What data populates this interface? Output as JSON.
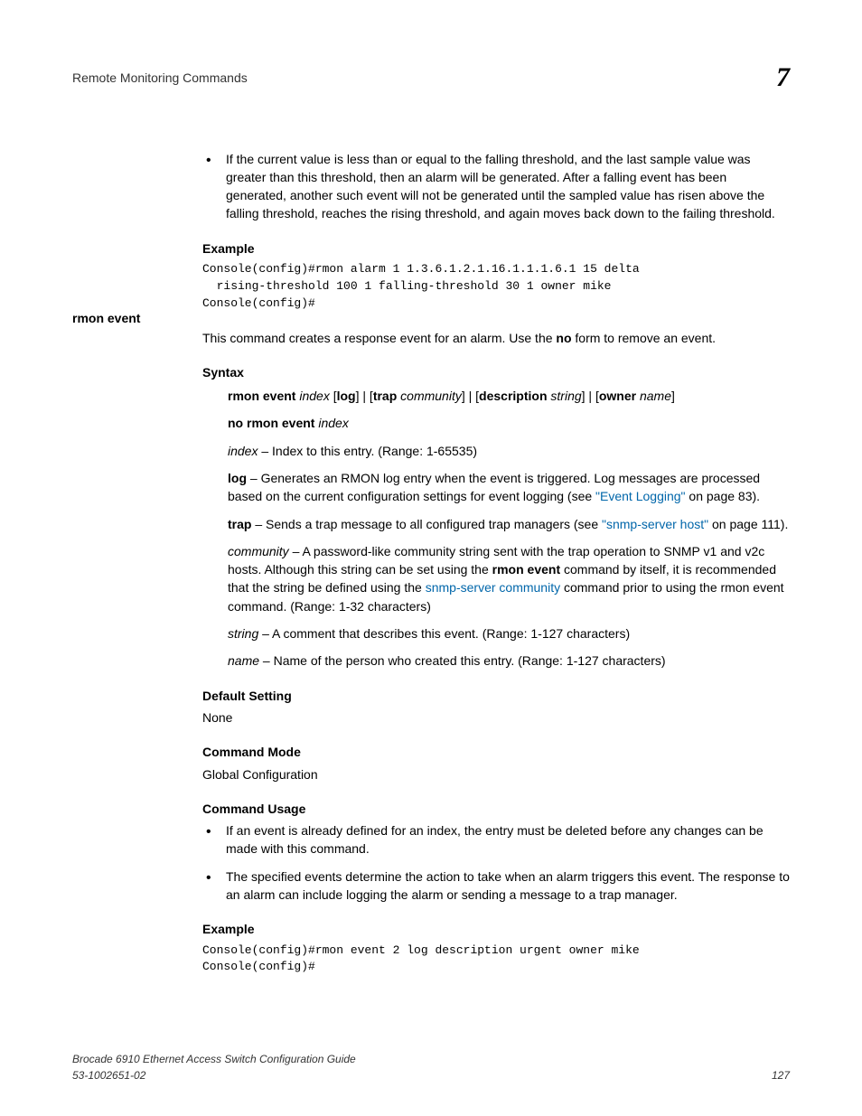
{
  "header": {
    "title": "Remote Monitoring Commands",
    "chapter": "7"
  },
  "top_bullet": "If the current value is less than or equal to the falling threshold, and the last sample value was greater than this threshold, then an alarm will be generated. After a falling event has been generated, another such event will not be generated until the sampled value has risen above the falling threshold, reaches the rising threshold, and again moves back down to the failing threshold.",
  "example1_head": "Example",
  "example1_code": "Console(config)#rmon alarm 1 1.3.6.1.2.1.16.1.1.1.6.1 15 delta \n  rising-threshold 100 1 falling-threshold 30 1 owner mike\nConsole(config)#",
  "side_heading": "rmon event",
  "intro_pre": "This command creates a response event for an alarm. Use the ",
  "intro_bold": "no",
  "intro_post": " form to remove an event.",
  "syntax_head": "Syntax",
  "syntax": {
    "l1_p1": "rmon event ",
    "l1_i1": "index",
    "l1_p2": " [",
    "l1_b1": "log",
    "l1_p3": "] | [",
    "l1_b2": "trap ",
    "l1_i2": "community",
    "l1_p4": "] | [",
    "l1_b3": "description ",
    "l1_i3": "string",
    "l1_p5": "] | [",
    "l1_b4": "owner ",
    "l1_i4": "name",
    "l1_p6": "]",
    "l2_b": "no rmon event ",
    "l2_i": "index"
  },
  "params": {
    "index_i": "index",
    "index_t": " – Index to this entry. (Range: 1-65535)",
    "log_b": "log",
    "log_t1": " – Generates an RMON log entry when the event is triggered. Log messages are processed based on the current configuration settings for event logging (see ",
    "log_link": "\"Event Logging\"",
    "log_t2": " on page 83).",
    "trap_b": "trap",
    "trap_t1": " – Sends a trap message to all configured trap managers (see ",
    "trap_link": "\"snmp-server host\"",
    "trap_t2": " on page 111).",
    "comm_i": "community",
    "comm_t1": " – A password-like community string sent with the trap operation to SNMP v1 and v2c hosts. Although this string can be set using the ",
    "comm_b": "rmon event",
    "comm_t2": " command by itself, it is recommended that the string be defined using the ",
    "comm_link": "snmp-server community",
    "comm_t3": " command prior to using the rmon event command. (Range: 1-32 characters)",
    "string_i": "string",
    "string_t": " – A comment that describes this event. (Range: 1-127 characters)",
    "name_i": "name",
    "name_t": " – Name of the person who created this entry. (Range: 1-127 characters)"
  },
  "default_head": "Default Setting",
  "default_val": "None",
  "mode_head": "Command Mode",
  "mode_val": "Global Configuration",
  "usage_head": "Command Usage",
  "usage_b1": "If an event is already defined for an index, the entry must be deleted before any changes can be made with this command.",
  "usage_b2": "The specified events determine the action to take when an alarm triggers this event. The response to an alarm can include logging the alarm or sending a message to a trap manager.",
  "example2_head": "Example",
  "example2_code": "Console(config)#rmon event 2 log description urgent owner mike \nConsole(config)#",
  "footer": {
    "line1": "Brocade 6910 Ethernet Access Switch Configuration Guide",
    "line2": "53-1002651-02",
    "page": "127"
  }
}
